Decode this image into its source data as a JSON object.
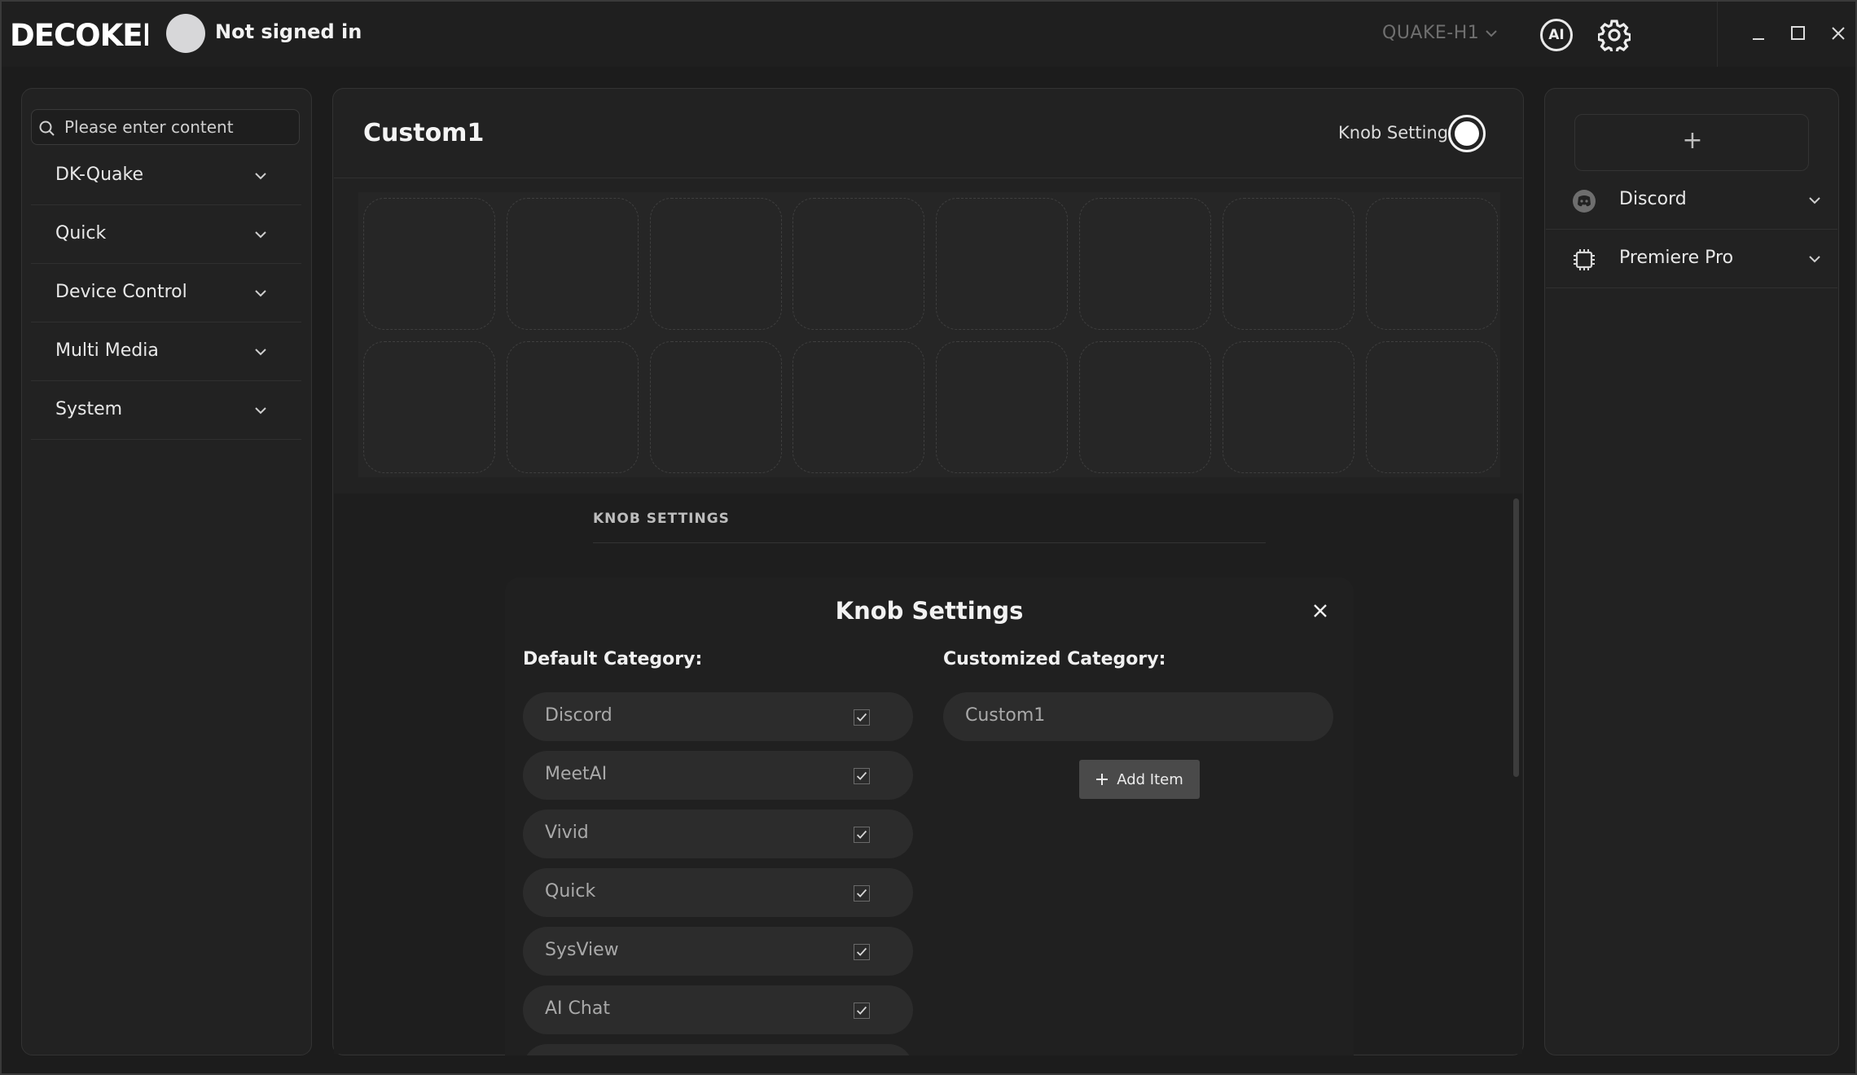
{
  "titlebar": {
    "logo_text": "DECOKEE",
    "user_status": "Not signed in",
    "device": "QUAKE-H1",
    "ai_label": "AI"
  },
  "sidebar": {
    "search_placeholder": "Please enter content",
    "categories": [
      {
        "label": "DK-Quake"
      },
      {
        "label": "Quick"
      },
      {
        "label": "Device Control"
      },
      {
        "label": "Multi Media"
      },
      {
        "label": "System"
      }
    ]
  },
  "main": {
    "title": "Custom1",
    "knob_setting_label": "Knob Setting",
    "knob_setting_enabled": true,
    "key_rows": 2,
    "key_cols": 8,
    "section_title": "KNOB SETTINGS"
  },
  "modal": {
    "title": "Knob Settings",
    "default_heading": "Default Category:",
    "custom_heading": "Customized Category:",
    "default_items": [
      {
        "label": "Discord",
        "checked": true
      },
      {
        "label": "MeetAI",
        "checked": true
      },
      {
        "label": "Vivid",
        "checked": true
      },
      {
        "label": "Quick",
        "checked": true
      },
      {
        "label": "SysView",
        "checked": true
      },
      {
        "label": "AI Chat",
        "checked": true
      }
    ],
    "custom_items": [
      {
        "label": "Custom1"
      }
    ],
    "add_item_label": "Add Item"
  },
  "right_panel": {
    "add_symbol": "+",
    "items": [
      {
        "label": "Discord",
        "icon": "discord-icon"
      },
      {
        "label": "Premiere Pro",
        "icon": "chip-icon"
      }
    ]
  }
}
